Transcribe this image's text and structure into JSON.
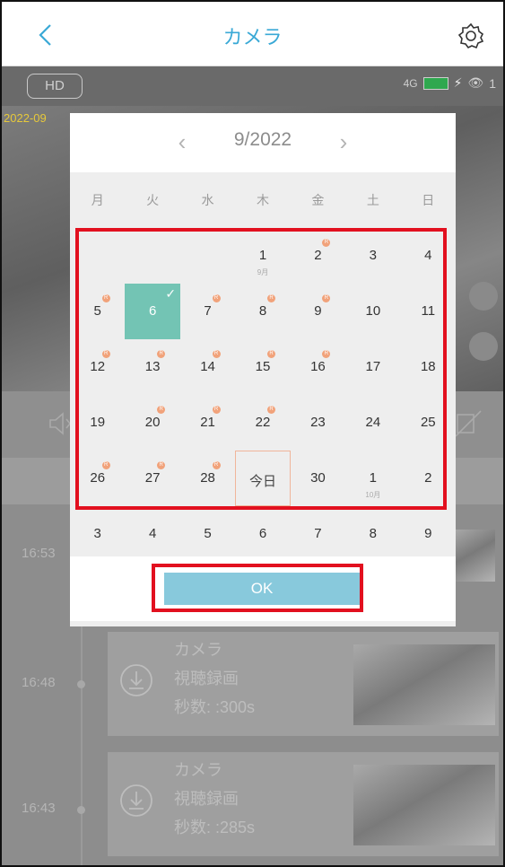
{
  "header": {
    "title": "カメラ",
    "back_icon": "chevron-left-icon",
    "settings_icon": "gear-icon"
  },
  "live": {
    "quality_label": "HD",
    "signal_label": "4G",
    "viewer_count": "1",
    "timestamp": "2022-09"
  },
  "calendar": {
    "month_label": "9/2022",
    "weekdays": [
      "月",
      "火",
      "水",
      "木",
      "金",
      "土",
      "日"
    ],
    "weeks": [
      [
        {
          "d": ""
        },
        {
          "d": ""
        },
        {
          "d": ""
        },
        {
          "d": "1",
          "sub": "9月"
        },
        {
          "d": "2",
          "rec": true
        },
        {
          "d": "3"
        },
        {
          "d": "4"
        }
      ],
      [
        {
          "d": "5",
          "rec": true
        },
        {
          "d": "6",
          "selected": true
        },
        {
          "d": "7",
          "rec": true
        },
        {
          "d": "8",
          "rec": true
        },
        {
          "d": "9",
          "rec": true
        },
        {
          "d": "10"
        },
        {
          "d": "11"
        }
      ],
      [
        {
          "d": "12",
          "rec": true
        },
        {
          "d": "13",
          "rec": true
        },
        {
          "d": "14",
          "rec": true
        },
        {
          "d": "15",
          "rec": true
        },
        {
          "d": "16",
          "rec": true
        },
        {
          "d": "17"
        },
        {
          "d": "18"
        }
      ],
      [
        {
          "d": "19"
        },
        {
          "d": "20",
          "rec": true
        },
        {
          "d": "21",
          "rec": true
        },
        {
          "d": "22",
          "rec": true
        },
        {
          "d": "23"
        },
        {
          "d": "24"
        },
        {
          "d": "25"
        }
      ],
      [
        {
          "d": "26",
          "rec": true
        },
        {
          "d": "27",
          "rec": true
        },
        {
          "d": "28",
          "rec": true
        },
        {
          "d": "今日",
          "today": true
        },
        {
          "d": "30"
        },
        {
          "d": "1",
          "sub": "10月"
        },
        {
          "d": "2"
        }
      ],
      [
        {
          "d": "3"
        },
        {
          "d": "4"
        },
        {
          "d": "5"
        },
        {
          "d": "6"
        },
        {
          "d": "7"
        },
        {
          "d": "8"
        },
        {
          "d": "9"
        }
      ]
    ],
    "rec_mark_label": "R",
    "ok_label": "OK",
    "colors": {
      "selected": "#73c4b4",
      "record_mark": "#f1a27a",
      "ok_button": "#88c9dc",
      "highlight": "#e2101f"
    }
  },
  "recordings": [
    {
      "time": "16:53"
    },
    {
      "time": "16:48",
      "camera": "カメラ",
      "type": "視聴録画",
      "duration": "秒数: :300s"
    },
    {
      "time": "16:43",
      "camera": "カメラ",
      "type": "視聴録画",
      "duration": "秒数: :285s"
    }
  ]
}
